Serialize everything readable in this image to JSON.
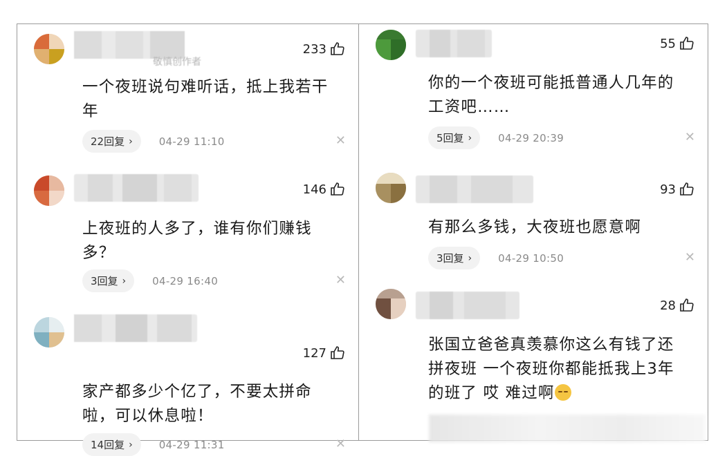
{
  "left": [
    {
      "likes": "233",
      "text": "一个夜班说句难听话，抵上我若干\n年",
      "replies": "22回复",
      "time": "04-29  11:10",
      "subname": "敬慎创作者"
    },
    {
      "likes": "146",
      "text": "上夜班的人多了，谁有你们赚钱\n多？",
      "replies": "3回复",
      "time": "04-29  16:40",
      "subname": ""
    },
    {
      "likes": "127",
      "text": "家产都多少个亿了，不要太拼命\n啦，可以休息啦！",
      "replies": "14回复",
      "time": "04-29  11:31",
      "subname": ""
    }
  ],
  "right": [
    {
      "likes": "55",
      "text": "你的一个夜班可能抵普通人几年的\n工资吧……",
      "replies": "5回复",
      "time": "04-29  20:39"
    },
    {
      "likes": "93",
      "text": "有那么多钱，大夜班也愿意啊",
      "replies": "3回复",
      "time": "04-29  10:50"
    },
    {
      "likes": "28",
      "text": "张国立爸爸真羡慕你这么有钱了还\n拼夜班 一个夜班你都能抵我上3年\n的班了 哎 难过啊",
      "replies": "",
      "time": ""
    }
  ],
  "colors": {
    "accent": "#222222",
    "meta": "#8a8a8a",
    "chip_bg": "#f2f2f2"
  },
  "icons": {
    "like": "thumbs-up-icon",
    "close": "close-icon",
    "chevron": "chevron-right-icon",
    "emoji": "sad-face-emoji"
  }
}
